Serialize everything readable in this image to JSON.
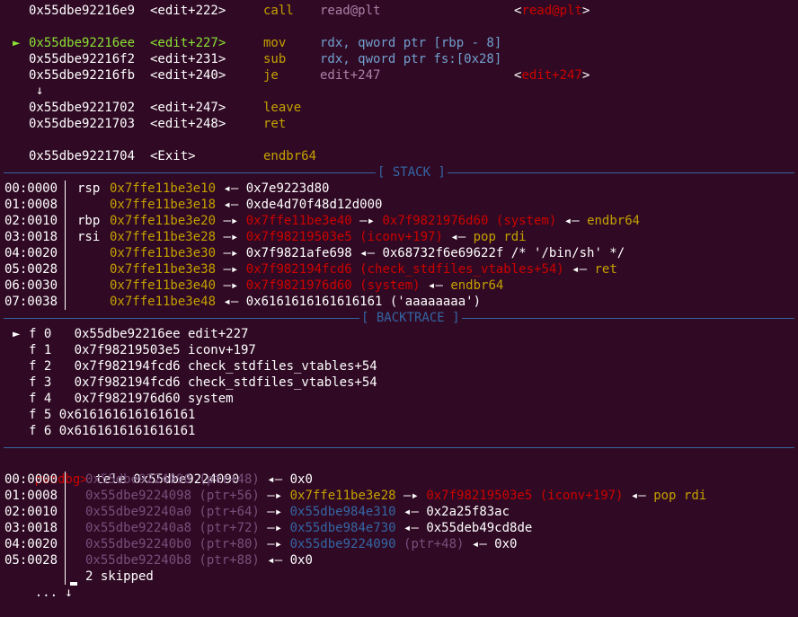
{
  "disasm": [
    {
      "mark": "",
      "addr": "0x55dbe92216e9",
      "sym": "<edit+222>",
      "mn": "call",
      "op": "read@plt",
      "cm": "<read@plt>",
      "hl": false
    },
    {
      "mark": "►",
      "addr": "0x55dbe92216ee",
      "sym": "<edit+227>",
      "mn": "mov",
      "op": "rdx, qword ptr [rbp - 8]",
      "cm": "",
      "hl": true
    },
    {
      "mark": "",
      "addr": "0x55dbe92216f2",
      "sym": "<edit+231>",
      "mn": "sub",
      "op": "rdx, qword ptr fs:[0x28]",
      "cm": "",
      "hl": false
    },
    {
      "mark": "",
      "addr": "0x55dbe92216fb",
      "sym": "<edit+240>",
      "mn": "je",
      "op": "edit+247",
      "cm": "<edit+247>",
      "hl": false
    },
    {
      "mark": "",
      "addr": "0x55dbe9221702",
      "sym": "<edit+247>",
      "mn": "leave",
      "op": "",
      "cm": "",
      "hl": false
    },
    {
      "mark": "",
      "addr": "0x55dbe9221703",
      "sym": "<edit+248>",
      "mn": "ret",
      "op": "",
      "cm": "",
      "hl": false
    },
    {
      "mark": "",
      "addr": "0x55dbe9221704",
      "sym": "<Exit>",
      "mn": "endbr64",
      "op": "",
      "cm": "",
      "hl": false
    }
  ],
  "jump_arrow": "↓",
  "stack_title": "[ STACK ]",
  "stack": [
    {
      "off": "00:0000",
      "reg": "rsp",
      "addr": "0x7ffe11be3e10",
      "rest": [
        [
          "w",
          " ◂— 0x7e9223d80"
        ]
      ]
    },
    {
      "off": "01:0008",
      "reg": "",
      "addr": "0x7ffe11be3e18",
      "rest": [
        [
          "w",
          " ◂— 0xde4d70f48d12d000"
        ]
      ]
    },
    {
      "off": "02:0010",
      "reg": "rbp",
      "addr": "0x7ffe11be3e20",
      "rest": [
        [
          "w",
          " —▸ "
        ],
        [
          "r",
          "0x7ffe11be3e40"
        ],
        [
          "w",
          " —▸ "
        ],
        [
          "r",
          "0x7f9821976d60 (system)"
        ],
        [
          "w",
          " ◂— "
        ],
        [
          "ye",
          "endbr64"
        ]
      ]
    },
    {
      "off": "03:0018",
      "reg": "rsi",
      "addr": "0x7ffe11be3e28",
      "rest": [
        [
          "w",
          " —▸ "
        ],
        [
          "r",
          "0x7f98219503e5 (iconv+197)"
        ],
        [
          "w",
          " ◂— "
        ],
        [
          "ye",
          "pop rdi"
        ]
      ]
    },
    {
      "off": "04:0020",
      "reg": "",
      "addr": "0x7ffe11be3e30",
      "rest": [
        [
          "w",
          " —▸ 0x7f9821afe698 ◂— 0x68732f6e69622f /* '/bin/sh' */"
        ]
      ]
    },
    {
      "off": "05:0028",
      "reg": "",
      "addr": "0x7ffe11be3e38",
      "rest": [
        [
          "w",
          " —▸ "
        ],
        [
          "r",
          "0x7f982194fcd6 (check_stdfiles_vtables+54)"
        ],
        [
          "w",
          " ◂— "
        ],
        [
          "ye",
          "ret"
        ]
      ]
    },
    {
      "off": "06:0030",
      "reg": "",
      "addr": "0x7ffe11be3e40",
      "rest": [
        [
          "w",
          " —▸ "
        ],
        [
          "r",
          "0x7f9821976d60 (system)"
        ],
        [
          "w",
          " ◂— "
        ],
        [
          "ye",
          "endbr64"
        ]
      ]
    },
    {
      "off": "07:0038",
      "reg": "",
      "addr": "0x7ffe11be3e48",
      "rest": [
        [
          "w",
          " ◂— 0x6161616161616161 ('aaaaaaaa')"
        ]
      ]
    }
  ],
  "backtrace_title": "[ BACKTRACE ]",
  "backtrace": [
    {
      "mark": "►",
      "text": "f 0   0x55dbe92216ee edit+227"
    },
    {
      "mark": "",
      "text": "f 1   0x7f98219503e5 iconv+197"
    },
    {
      "mark": "",
      "text": "f 2   0x7f982194fcd6 check_stdfiles_vtables+54"
    },
    {
      "mark": "",
      "text": "f 3   0x7f982194fcd6 check_stdfiles_vtables+54"
    },
    {
      "mark": "",
      "text": "f 4   0x7f9821976d60 system"
    },
    {
      "mark": "",
      "text": "f 5 0x6161616161616161"
    },
    {
      "mark": "",
      "text": "f 6 0x6161616161616161"
    }
  ],
  "prompt": "pwndbg>",
  "command": " tele 0x55dbe9224090",
  "tele": [
    {
      "off": "00:0000",
      "rest": [
        [
          "p",
          "0x55dbe9224090 (ptr+48)"
        ],
        [
          "w",
          " ◂— 0x0"
        ]
      ]
    },
    {
      "off": "01:0008",
      "rest": [
        [
          "p",
          "0x55dbe9224098 (ptr+56)"
        ],
        [
          "w",
          " —▸ "
        ],
        [
          "ye",
          "0x7ffe11be3e28"
        ],
        [
          "w",
          " —▸ "
        ],
        [
          "r",
          "0x7f98219503e5 (iconv+197)"
        ],
        [
          "w",
          " ◂— "
        ],
        [
          "ye",
          "pop rdi"
        ]
      ]
    },
    {
      "off": "02:0010",
      "rest": [
        [
          "p",
          "0x55dbe92240a0 (ptr+64)"
        ],
        [
          "w",
          " —▸ "
        ],
        [
          "b",
          "0x55dbe984e310"
        ],
        [
          "w",
          " ◂— 0x2a25f83ac"
        ]
      ]
    },
    {
      "off": "03:0018",
      "rest": [
        [
          "p",
          "0x55dbe92240a8 (ptr+72)"
        ],
        [
          "w",
          " —▸ "
        ],
        [
          "b",
          "0x55dbe984e730"
        ],
        [
          "w",
          " ◂— 0x55deb49cd8de"
        ]
      ]
    },
    {
      "off": "04:0020",
      "rest": [
        [
          "p",
          "0x55dbe92240b0 (ptr+80)"
        ],
        [
          "w",
          " —▸ "
        ],
        [
          "b",
          "0x55dbe9224090"
        ],
        [
          "p",
          " (ptr+48)"
        ],
        [
          "w",
          " ◂— 0x0"
        ]
      ]
    },
    {
      "off": "05:0028",
      "rest": [
        [
          "p",
          "0x55dbe92240b8 (ptr+88)"
        ],
        [
          "w",
          " ◂— 0x0"
        ]
      ]
    }
  ],
  "skip_prefix": "... ↓",
  "skip_text": "2 skipped"
}
